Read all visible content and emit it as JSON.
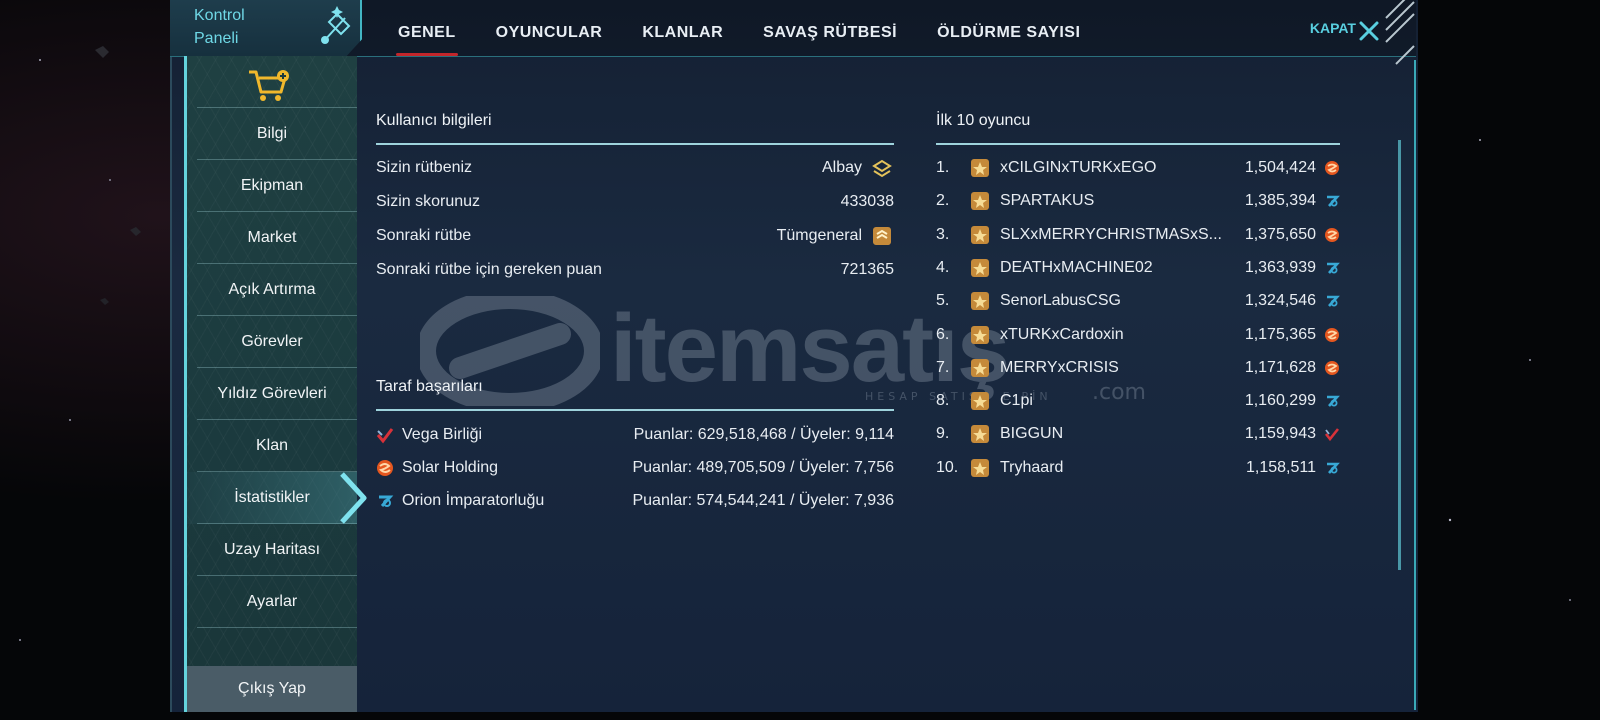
{
  "header": {
    "panel_title": "Kontrol\nPaneli",
    "tabs": [
      "GENEL",
      "OYUNCULAR",
      "KLANLAR",
      "SAVAŞ RÜTBESİ",
      "ÖLDÜRME SAYISI"
    ],
    "active_tab": "GENEL",
    "close_label": "KAPAT"
  },
  "sidebar": {
    "items": [
      "Bilgi",
      "Ekipman",
      "Market",
      "Açık Artırma",
      "Görevler",
      "Yıldız Görevleri",
      "Klan",
      "İstatistikler",
      "Uzay Haritası",
      "Ayarlar"
    ],
    "active_item": "İstatistikler",
    "logout": "Çıkış Yap"
  },
  "user_info": {
    "title": "Kullanıcı bilgileri",
    "rows": [
      {
        "label": "Sizin rütbeniz",
        "value": "Albay",
        "icon": "rank-colonel-icon"
      },
      {
        "label": "Sizin skorunuz",
        "value": "433038"
      },
      {
        "label": "Sonraki rütbe",
        "value": "Tümgeneral",
        "icon": "rank-major-general-icon"
      },
      {
        "label": "Sonraki rütbe için gereken puan",
        "value": "721365"
      }
    ]
  },
  "factions": {
    "title": "Taraf başarıları",
    "rows": [
      {
        "name": "Vega Birliği",
        "stats": "Puanlar: 629,518,468 / Üyeler: 9,114",
        "icon": "vega-faction-icon",
        "color": "#d7323a"
      },
      {
        "name": "Solar Holding",
        "stats": "Puanlar: 489,705,509 / Üyeler: 7,756",
        "icon": "solar-faction-icon",
        "color": "#e5571f"
      },
      {
        "name": "Orion İmparatorluğu",
        "stats": "Puanlar: 574,544,241 / Üyeler: 7,936",
        "icon": "orion-faction-icon",
        "color": "#38a9d6"
      }
    ]
  },
  "top10": {
    "title": "İlk 10 oyuncu",
    "rows": [
      {
        "rank": "1.",
        "name": "xCILGINxTURKxEGO",
        "score": "1,504,424",
        "faction": "solar"
      },
      {
        "rank": "2.",
        "name": "SPARTAKUS",
        "score": "1,385,394",
        "faction": "orion"
      },
      {
        "rank": "3.",
        "name": "SLXxMERRYCHRISTMASxS...",
        "score": "1,375,650",
        "faction": "solar"
      },
      {
        "rank": "4.",
        "name": "DEATHxMACHINE02",
        "score": "1,363,939",
        "faction": "orion"
      },
      {
        "rank": "5.",
        "name": "SenorLabusCSG",
        "score": "1,324,546",
        "faction": "orion"
      },
      {
        "rank": "6.",
        "name": "xTURKxCardoxin",
        "score": "1,175,365",
        "faction": "solar"
      },
      {
        "rank": "7.",
        "name": "MERRYxCRISIS",
        "score": "1,171,628",
        "faction": "solar"
      },
      {
        "rank": "8.",
        "name": "C1pi",
        "score": "1,160,299",
        "faction": "orion"
      },
      {
        "rank": "9.",
        "name": "BIGGUN",
        "score": "1,159,943",
        "faction": "vega"
      },
      {
        "rank": "10.",
        "name": "Tryhaard",
        "score": "1,158,511",
        "faction": "orion"
      }
    ]
  },
  "watermark": {
    "text": "itemsatış",
    "subtext": "HESAP SATIŞ / E-PİN",
    "suffix": ".com"
  },
  "colors": {
    "accent": "#5fd1df",
    "tab_underline": "#c3262b",
    "rank_badge": "#c58a3a"
  }
}
